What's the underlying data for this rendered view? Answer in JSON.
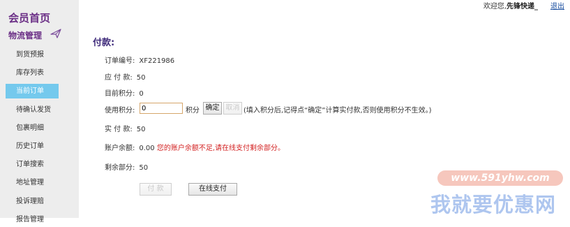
{
  "sidebar": {
    "title": "会员首页",
    "section": "物流管理",
    "items": [
      {
        "label": "到货预报",
        "active": false
      },
      {
        "label": "库存列表",
        "active": false
      },
      {
        "label": "当前订单",
        "active": true
      },
      {
        "label": "待确认发货",
        "active": false
      },
      {
        "label": "包裹明细",
        "active": false
      },
      {
        "label": "历史订单",
        "active": false
      },
      {
        "label": "订单搜索",
        "active": false
      },
      {
        "label": "地址管理",
        "active": false
      },
      {
        "label": "投诉理赔",
        "active": false
      },
      {
        "label": "报告管理",
        "active": false
      }
    ]
  },
  "topbar": {
    "welcome": "欢迎您,",
    "username": "先锋快递_",
    "logout": "退出"
  },
  "payment": {
    "title": "付款:",
    "order_no_label": "订单编号:",
    "order_no": "XF221986",
    "due_label": "应 付 款:",
    "due": "50",
    "points_label": "目前积分:",
    "points": "0",
    "use_points_label": "使用积分:",
    "use_points_value": "0",
    "points_unit": "积分",
    "confirm_label": "确定",
    "cancel_label": "取消",
    "hint": "(填入积分后,记得点“确定”计算实付款,否则使用积分不生效。)",
    "actual_label": "实 付 款:",
    "actual": "50",
    "balance_label": "账户余额:",
    "balance": "0.00",
    "balance_warning": "您的账户余额不足,请在线支付剩余部分。",
    "remaining_label": "剩余部分:",
    "remaining": "50",
    "pay_label": "付 款",
    "online_pay_label": "在线支付"
  },
  "watermark": {
    "url": "www.591yhw.com",
    "name": "我就要优惠网"
  },
  "colors": {
    "accent": "#6b2f86",
    "active_nav": "#74c9ed",
    "warning": "#d32222",
    "link": "#1a4fa0"
  }
}
